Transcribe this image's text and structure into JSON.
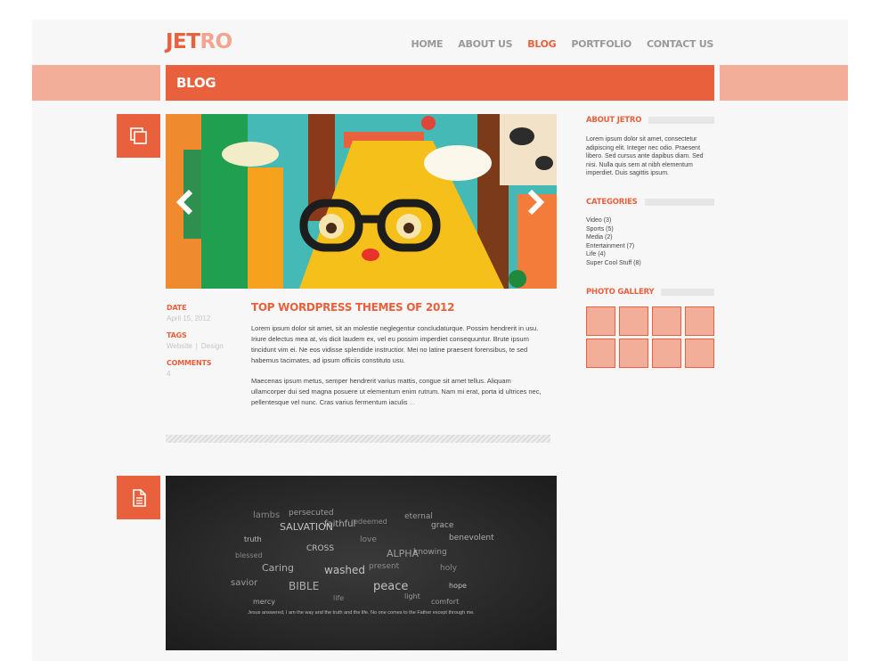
{
  "site": {
    "logo_part1": "JET",
    "logo_part2": "RO"
  },
  "nav": {
    "items": [
      {
        "label": "HOME"
      },
      {
        "label": "ABOUT US"
      },
      {
        "label": "BLOG"
      },
      {
        "label": "PORTFOLIO"
      },
      {
        "label": "CONTACT US"
      }
    ],
    "active": "BLOG"
  },
  "page": {
    "title": "BLOG"
  },
  "colors": {
    "accent": "#e8603c",
    "accent_light": "#f2ae99",
    "text": "#444444",
    "meta": "#c5c5c5"
  },
  "post": {
    "icon": "gallery-icon",
    "meta": {
      "date_label": "DATE",
      "date": "April 15, 2012",
      "tags_label": "TAGS",
      "tags": [
        "Website",
        "Design"
      ],
      "tag_separator": "|",
      "comments_label": "COMMENTS",
      "comments": "4"
    },
    "title": "TOP WORDPRESS THEMES OF 2012",
    "paragraph1": "Lorem ipsum dolor sit amet, sit an molestie neglegentur concludaturque. Possim hendrerit in usu. Iriure delectus mea at, vis dicit laudem ex, vel eu possim imperdiet consequuntur. Brute ipsum tincidunt vim ei. Ne eos vidisse splendide instructior. Mei no latine praesent forensibus, te sed habemus tacimates, ad ipsum officiis constituto usu.",
    "paragraph2": "Maecenas ipsum metus, semper hendrerit varius mattis, congue sit amet tellus. Aliquam ullamcorper dui sed magna posuere ut elementum enim rutrum. Nam mi erat, porta id ultrices nec, pellentesque vel nunc. Cras varius fermentum iaculis",
    "read_more": "..."
  },
  "post2": {
    "icon": "document-icon",
    "caption": "Jesus answered,   I am the way and the truth and the life. No one comes to the Father except through me.",
    "cloud_words": [
      "lambs",
      "persecuted",
      "faithful",
      "SALVATION",
      "redeemed",
      "eternal",
      "grace",
      "CROSS",
      "love",
      "ALPHA",
      "Caring",
      "washed",
      "present",
      "savior",
      "BIBLE",
      "peace",
      "holy",
      "knowing",
      "benevolent",
      "truth",
      "life",
      "light",
      "mercy",
      "hope",
      "blessed",
      "comfort"
    ]
  },
  "sidebar": {
    "about": {
      "title": "ABOUT JETRO",
      "text": "Lorem ipsum dolor sit amet, consectetur adipiscing elit. Integer nec odio. Praesent libero. Sed cursus ante dapibus diam. Sed nisi. Nulla quis sem at nibh elementum imperdiet. Duis sagittis ipsum."
    },
    "categories": {
      "title": "CATEGORIES",
      "items": [
        {
          "label": "Video (3)"
        },
        {
          "label": "Sports (5)"
        },
        {
          "label": "Media (2)"
        },
        {
          "label": "Entertainment (7)"
        },
        {
          "label": "Life (4)"
        },
        {
          "label": "Super Cool Stuff (8)"
        }
      ]
    },
    "gallery": {
      "title": "PHOTO GALLERY",
      "count": 8
    }
  }
}
